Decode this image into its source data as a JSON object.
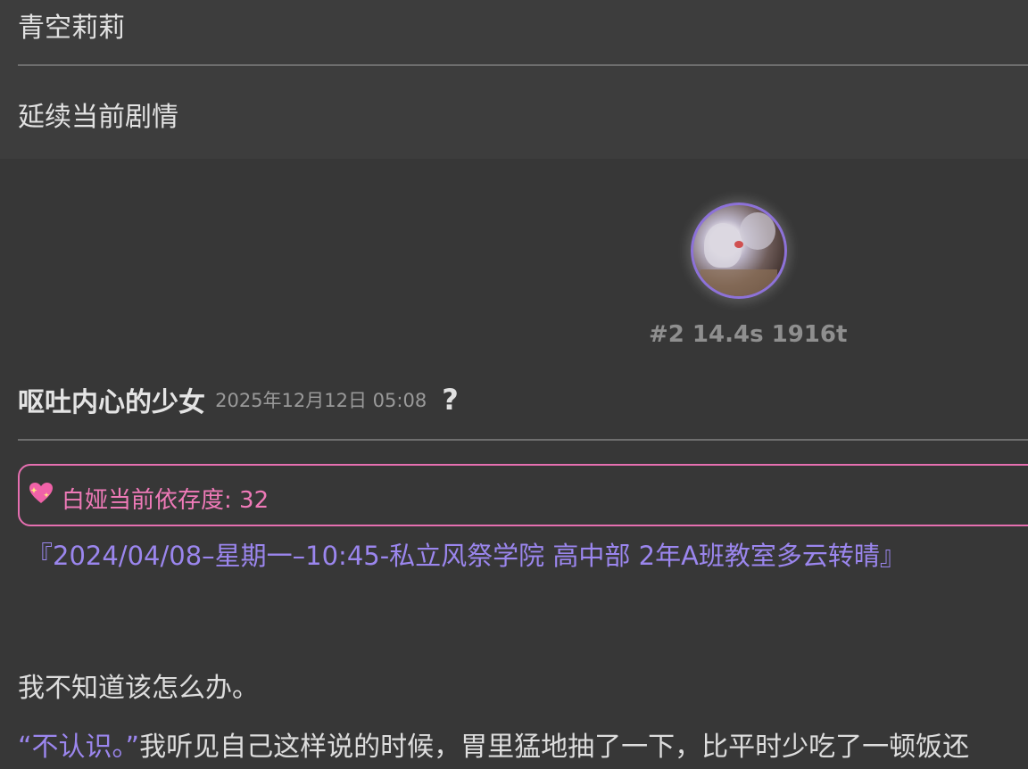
{
  "header": {
    "character_name": "青空莉莉",
    "continue_label": "延续当前剧情"
  },
  "message": {
    "stats": "#2 14.4s 1916t",
    "sender": "呕吐内心的少女",
    "timestamp": "2025年12月12日 05:08",
    "help_glyph": "?",
    "status": {
      "icon": "sparkling-heart-icon",
      "text": "白娅当前依存度: 32"
    },
    "scene": "『2024/04/08–星期一–10:45-私立风祭学院 高中部 2年A班教室多云转晴』",
    "paragraph1": "我不知道该怎么办。",
    "paragraph2_quote": "“不认识。”",
    "paragraph2_rest": "我听见自己这样说的时候，胃里猛地抽了一下，比平时少吃了一顿饭还"
  },
  "colors": {
    "background": "#373737",
    "top_panel": "#3d3d3d",
    "accent_purple": "#9b86ee",
    "accent_pink": "#ef7ab8",
    "avatar_border": "#8d72d8"
  }
}
